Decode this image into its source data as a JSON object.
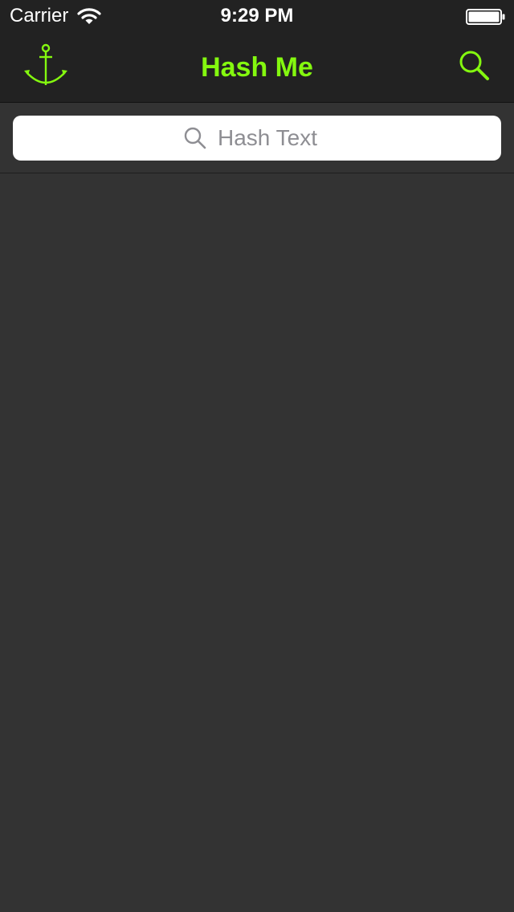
{
  "status_bar": {
    "carrier": "Carrier",
    "time": "9:29 PM"
  },
  "nav_bar": {
    "title": "Hash Me",
    "left_icon": "anchor-icon",
    "right_icon": "search-icon"
  },
  "search": {
    "placeholder": "Hash Text",
    "value": ""
  },
  "colors": {
    "accent": "#84f80f",
    "bar_background": "#222222",
    "content_background": "#333333",
    "field_background": "#ffffff",
    "placeholder": "#8e8e93"
  }
}
